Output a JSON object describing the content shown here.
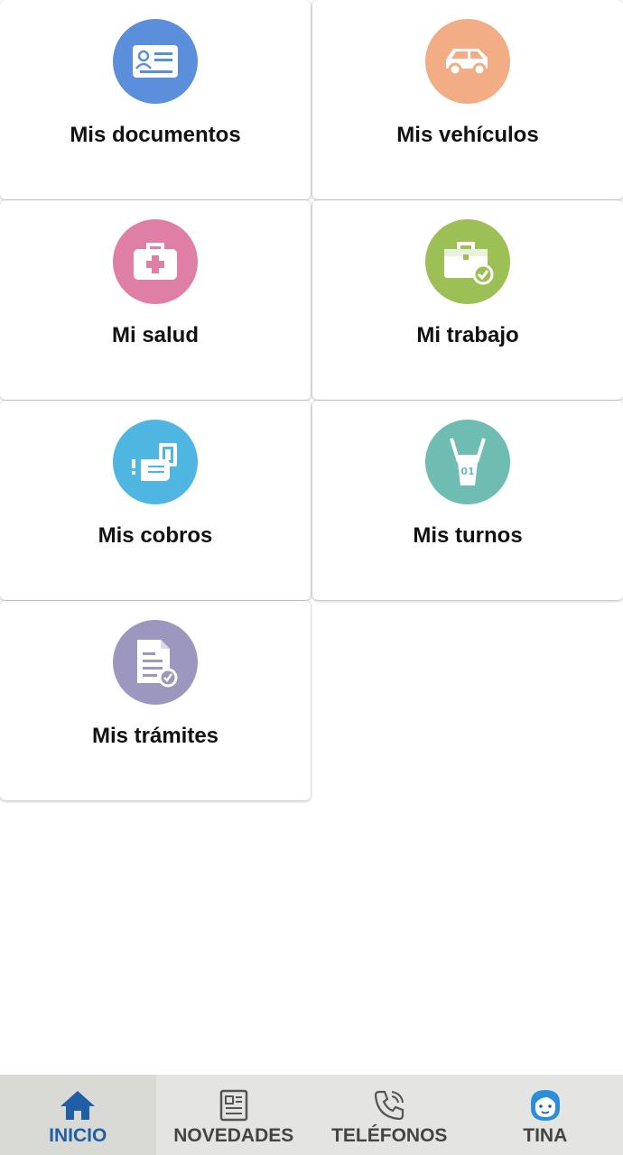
{
  "menu": [
    {
      "label": "Mis documentos",
      "icon": "id-card-icon",
      "color": "#5b8fdb"
    },
    {
      "label": "Mis vehículos",
      "icon": "car-icon",
      "color": "#f2ad84"
    },
    {
      "label": "Mi salud",
      "icon": "medical-kit-icon",
      "color": "#e07fa6"
    },
    {
      "label": "Mi trabajo",
      "icon": "briefcase-check-icon",
      "color": "#9cc055"
    },
    {
      "label": "Mis cobros",
      "icon": "hand-money-icon",
      "color": "#4fb6e2"
    },
    {
      "label": "Mis turnos",
      "icon": "ticket-number-icon",
      "color": "#6fbcb2"
    },
    {
      "label": "Mis trámites",
      "icon": "document-check-icon",
      "color": "#9b97bf"
    }
  ],
  "tabs": [
    {
      "label": "INICIO",
      "icon": "home-icon",
      "active": true
    },
    {
      "label": "NOVEDADES",
      "icon": "newspaper-icon",
      "active": false
    },
    {
      "label": "TELÉFONOS",
      "icon": "phone-icon",
      "active": false
    },
    {
      "label": "TINA",
      "icon": "tina-avatar-icon",
      "active": false
    }
  ],
  "colors": {
    "active_tab": "#1f5fa8",
    "inactive_tab": "#444444",
    "tabbar_bg": "#e4e4e2"
  }
}
